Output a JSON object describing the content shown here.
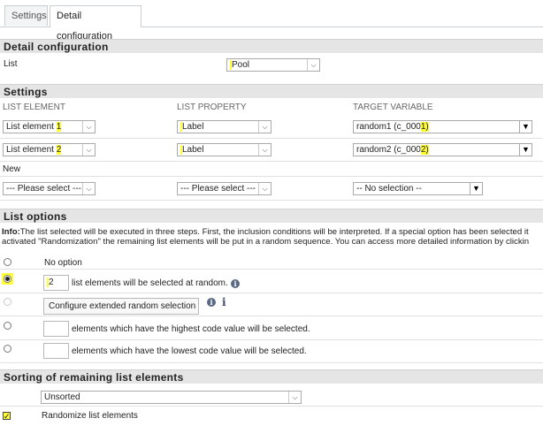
{
  "tabs": [
    {
      "label": "Settings"
    },
    {
      "label": "Detail configuration"
    }
  ],
  "detail": {
    "section_title": "Detail configuration",
    "list_label": "List",
    "list_value": "Pool"
  },
  "settings": {
    "section_title": "Settings",
    "col_list_element": "LIST ELEMENT",
    "col_list_property": "LIST PROPERTY",
    "col_target_variable": "TARGET VARIABLE",
    "rows": [
      {
        "element_prefix": "List element ",
        "element_num": "1",
        "property": "Label",
        "target_prefix": "random1 (c_000",
        "target_suffix": "1)"
      },
      {
        "element_prefix": "List element ",
        "element_num": "2",
        "property": "Label",
        "target_prefix": "random2 (c_000",
        "target_suffix": "2)"
      }
    ],
    "new_label": "New",
    "new_element": "--- Please select ---",
    "new_property": "--- Please select ---",
    "new_target": "-- No selection --"
  },
  "list_options": {
    "section_title": "List options",
    "info_bold": "Info:",
    "info_line1": "The list selected will be executed in three steps. First, the inclusion conditions will be interpreted. If a special option has been selected it",
    "info_line2": "activated \"Randomization\" the remaining list elements will be put in a random sequence. You can access more detailed information by clickin",
    "no_option": "No option",
    "random_count": "2",
    "random_text": "list elements will be selected at random.",
    "configure_button": "Configure extended random selection",
    "highest_text": "elements which have the highest code value will be selected.",
    "lowest_text": "elements which have the lowest code value will be selected."
  },
  "sorting": {
    "section_title": "Sorting of remaining list elements",
    "sort_value": "Unsorted",
    "randomize_label": "Randomize list elements"
  },
  "icons": {
    "dropdown": "chevron-down-icon",
    "info_circle": "info-circle-icon",
    "info_i": "info-icon",
    "checkmark": "checkmark-icon"
  },
  "colors": {
    "highlight": "#ffff33",
    "section_bg": "#e5e5e5"
  }
}
